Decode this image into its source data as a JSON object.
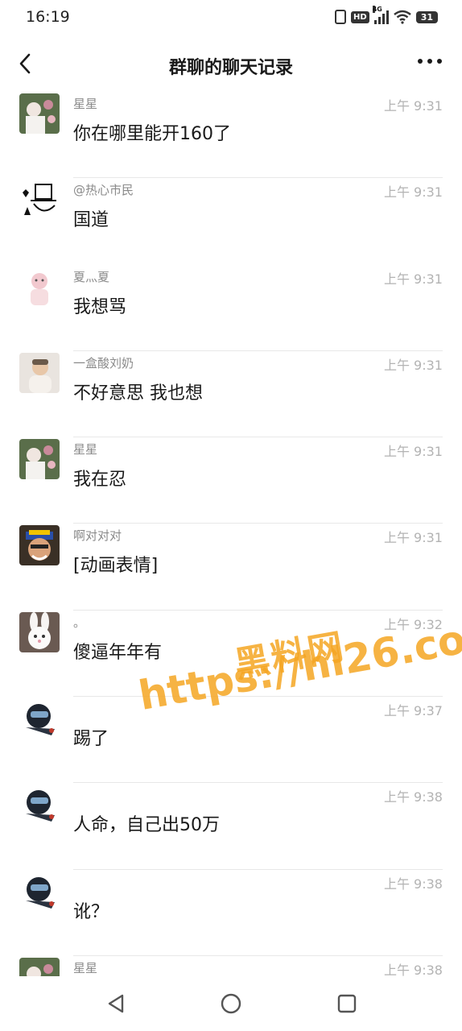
{
  "status_bar": {
    "time": "16:19",
    "network": "4G",
    "hd": "HD",
    "battery": "31"
  },
  "header": {
    "title": "群聊的聊天记录"
  },
  "messages": [
    {
      "sender": "星星",
      "time": "上午 9:31",
      "text": "你在哪里能开160了",
      "avatar": "photo-avatar-flowers"
    },
    {
      "sender": "@热心市民",
      "time": "上午 9:31",
      "text": "国道",
      "avatar": "drawing-avatar-hat"
    },
    {
      "sender": "夏灬夏",
      "time": "上午 9:31",
      "text": "我想骂",
      "avatar": "pink-avatar"
    },
    {
      "sender": "一盒酸刘奶",
      "time": "上午 9:31",
      "text": "不好意思  我也想",
      "avatar": "baby-avatar"
    },
    {
      "sender": "星星",
      "time": "上午 9:31",
      "text": "我在忍",
      "avatar": "photo-avatar-flowers"
    },
    {
      "sender": "啊对对对",
      "time": "上午 9:31",
      "text": "[动画表情]",
      "avatar": "cartoon-avatar"
    },
    {
      "sender": "。",
      "time": "上午 9:32",
      "text": "傻逼年年有",
      "avatar": "rabbit-avatar"
    },
    {
      "sender": "",
      "time": "上午 9:37",
      "text": "踢了",
      "avatar": "helmet-avatar"
    },
    {
      "sender": "",
      "time": "上午 9:38",
      "text": "人命，自己出50万",
      "avatar": "helmet-avatar"
    },
    {
      "sender": "",
      "time": "上午 9:38",
      "text": "讹？",
      "avatar": "helmet-avatar"
    },
    {
      "sender": "星星",
      "time": "上午 9:38",
      "text": "",
      "avatar": "photo-avatar-flowers"
    }
  ],
  "watermark": {
    "line1": "黑料网",
    "line2": "https://hl26.co"
  },
  "colors": {
    "accent_watermark": "#f5a623",
    "time_text": "#b3b3b3",
    "sender_text": "#8a8a8a"
  }
}
